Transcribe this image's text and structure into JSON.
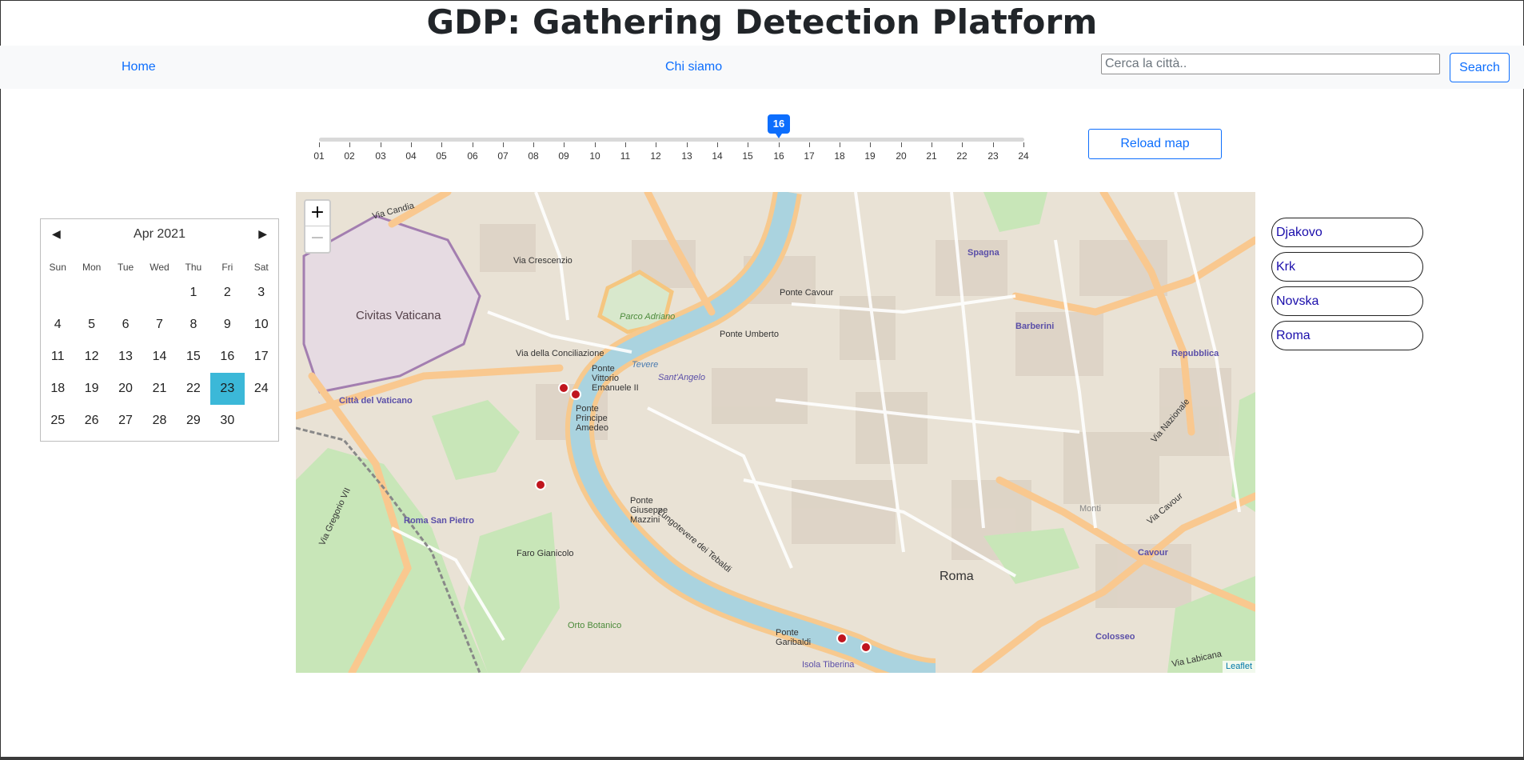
{
  "header": {
    "title": "GDP: Gathering Detection Platform"
  },
  "nav": {
    "home": "Home",
    "about": "Chi siamo",
    "search_placeholder": "Cerca la città..",
    "search_button": "Search"
  },
  "slider": {
    "ticks": [
      "01",
      "02",
      "03",
      "04",
      "05",
      "06",
      "07",
      "08",
      "09",
      "10",
      "11",
      "12",
      "13",
      "14",
      "15",
      "16",
      "17",
      "18",
      "19",
      "20",
      "21",
      "22",
      "23",
      "24"
    ],
    "value": "16"
  },
  "reload_button": "Reload map",
  "calendar": {
    "title": "Apr 2021",
    "weekdays": [
      "Sun",
      "Mon",
      "Tue",
      "Wed",
      "Thu",
      "Fri",
      "Sat"
    ],
    "weeks": [
      [
        "",
        "",
        "",
        "",
        "1",
        "2",
        "3"
      ],
      [
        "4",
        "5",
        "6",
        "7",
        "8",
        "9",
        "10"
      ],
      [
        "11",
        "12",
        "13",
        "14",
        "15",
        "16",
        "17"
      ],
      [
        "18",
        "19",
        "20",
        "21",
        "22",
        "23",
        "24"
      ],
      [
        "25",
        "26",
        "27",
        "28",
        "29",
        "30",
        ""
      ]
    ],
    "selected": "23",
    "prev_icon": "triangle-left-icon",
    "next_icon": "triangle-right-icon"
  },
  "map": {
    "zoom_in": "+",
    "zoom_out": "−",
    "attribution": "Leaflet",
    "labels": {
      "civitas": "Civitas Vaticana",
      "roma": "Roma",
      "citta_vaticano": "Città del Vaticano",
      "roma_san_pietro": "Roma San Pietro",
      "spagna": "Spagna",
      "barberini": "Barberini",
      "repubblica": "Repubblica",
      "cavour": "Cavour",
      "colosseo": "Colosseo",
      "monti": "Monti",
      "ponte_cavour": "Ponte Cavour",
      "ponte_umberto": "Ponte Umberto",
      "ponte_vittorio": "Ponte Vittorio Emanuele II",
      "ponte_principe": "Ponte Principe Amedeo",
      "ponte_mazzini": "Ponte Giuseppe Mazzini",
      "ponte_garibaldi": "Ponte Garibaldi",
      "lungotevere": "Lungotevere dei Tebaldi",
      "via_crescenzio": "Via Crescenzio",
      "via_candia": "Via Candia",
      "via_conciliazione": "Via della Conciliazione",
      "faro": "Faro Gianicolo",
      "orto": "Orto Botanico",
      "isola": "Isola Tiberina",
      "via_labicana": "Via Labicana",
      "via_cavour": "Via Cavour",
      "via_nazionale": "Via Nazionale",
      "via_gregorio": "Via Gregorio VII",
      "tevere": "Tevere",
      "parco": "Parco Adriano",
      "sant_angelo": "Sant'Angelo"
    }
  },
  "cities": [
    "Djakovo",
    "Krk",
    "Novska",
    "Roma"
  ],
  "colors": {
    "accent": "#0d6efd",
    "selected_day": "#3bb8d8",
    "river": "#aad3df",
    "major_road": "#f9c88f",
    "park": "#c8e6b8"
  }
}
